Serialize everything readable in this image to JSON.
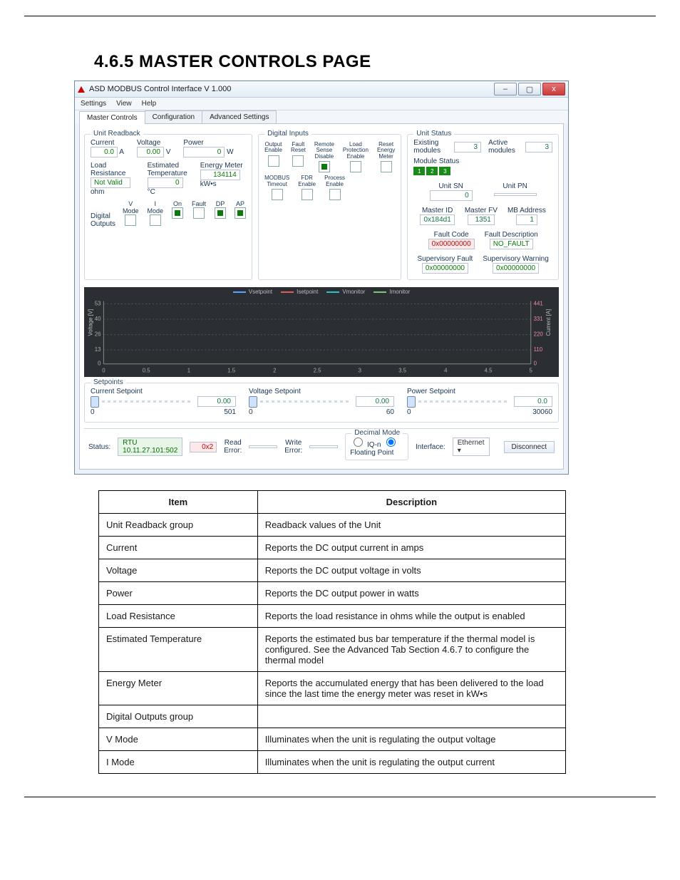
{
  "heading": "4.6.5  MASTER CONTROLS PAGE",
  "win": {
    "title": "ASD MODBUS Control Interface V 1.000",
    "menus": [
      "Settings",
      "View",
      "Help"
    ],
    "tabs": [
      "Master Controls",
      "Configuration",
      "Advanced Settings"
    ],
    "wbtn": {
      "min": "–",
      "max": "▢",
      "close": "x"
    }
  },
  "readback": {
    "legend": "Unit Readback",
    "current_lbl": "Current",
    "current_val": "0.0",
    "current_unit": "A",
    "voltage_lbl": "Voltage",
    "voltage_val": "0.00",
    "voltage_unit": "V",
    "power_lbl": "Power",
    "power_val": "0",
    "power_unit": "W",
    "loadres_lbl": "Load\nResistance",
    "loadres_val": "Not Valid",
    "loadres_unit": "ohm",
    "esttemp_lbl": "Estimated\nTemperature",
    "esttemp_val": "0",
    "esttemp_unit": "°C",
    "energy_lbl": "Energy Meter",
    "energy_val": "134114",
    "energy_unit": "kW•s",
    "dout_lbl": "Digital\nOutputs",
    "cols": {
      "vmode": "V Mode",
      "imode": "I Mode",
      "on": "On",
      "fault": "Fault",
      "dp": "DP",
      "ap": "AP"
    }
  },
  "digin": {
    "legend": "Digital Inputs",
    "row1": [
      {
        "a": "Output",
        "b": "Enable"
      },
      {
        "a": "Fault",
        "b": "Reset"
      },
      {
        "a": "Remote",
        "b": "Sense\nDisable"
      },
      {
        "a": "Load",
        "b": "Protection\nEnable"
      },
      {
        "a": "Reset",
        "b": "Energy\nMeter"
      }
    ],
    "row2": [
      {
        "a": "MODBUS",
        "b": "Timeout"
      },
      {
        "a": "FDR",
        "b": "Enable"
      },
      {
        "a": "Process",
        "b": "Enable"
      }
    ]
  },
  "unit": {
    "legend": "Unit Status",
    "existing_lbl": "Existing modules",
    "existing_val": "3",
    "active_lbl": "Active modules",
    "active_val": "3",
    "modstatus_lbl": "Module Status",
    "mods": [
      "1",
      "2",
      "3"
    ],
    "sn_lbl": "Unit SN",
    "sn_val": "0",
    "pn_lbl": "Unit PN",
    "pn_val": "",
    "mid_lbl": "Master ID",
    "mid_val": "0x184d1",
    "mfv_lbl": "Master FV",
    "mfv_val": "1351",
    "mba_lbl": "MB Address",
    "mba_val": "1",
    "fcode_lbl": "Fault Code",
    "fcode_val": "0x00000000",
    "fdesc_lbl": "Fault Description",
    "fdesc_val": "NO_FAULT",
    "sfault_lbl": "Supervisory Fault",
    "sfault_val": "0x00000000",
    "swarn_lbl": "Supervisory Warning",
    "swarn_val": "0x00000000"
  },
  "chart_data": {
    "type": "line",
    "title": "",
    "series": [
      {
        "name": "Vsetpoint",
        "color": "#52a7ff",
        "values": []
      },
      {
        "name": "Isetpoint",
        "color": "#e25b5b",
        "values": []
      },
      {
        "name": "Vmonitor",
        "color": "#2dc2c2",
        "values": []
      },
      {
        "name": "Imonitor",
        "color": "#7ac67a",
        "values": []
      }
    ],
    "x": {
      "label": "",
      "min": 0.0,
      "max": 5.0,
      "ticks": [
        0.0,
        0.5,
        1.0,
        1.5,
        2.0,
        2.5,
        3.0,
        3.5,
        4.0,
        4.5,
        5.0
      ]
    },
    "y_left": {
      "label": "Voltage [V]",
      "ticks": [
        0,
        13,
        26,
        40,
        53
      ]
    },
    "y_right": {
      "label": "Current [A]",
      "ticks": [
        0,
        110,
        220,
        331,
        441
      ]
    }
  },
  "setpoints": {
    "legend": "Setpoints",
    "current": {
      "lbl": "Current Setpoint",
      "val": "0.00",
      "min": "0",
      "max": "501"
    },
    "voltage": {
      "lbl": "Voltage Setpoint",
      "val": "0.00",
      "min": "0",
      "max": "60"
    },
    "power": {
      "lbl": "Power Setpoint",
      "val": "0.0",
      "min": "0",
      "max": "30060"
    }
  },
  "status": {
    "lbl": "Status:",
    "conn": "RTU 10.11.27.101:502",
    "err": "0x2",
    "readerr_a": "Read",
    "readerr_b": "Error:",
    "readerr_v": "",
    "writeerr_a": "Write",
    "writeerr_b": "Error:",
    "writeerr_v": "",
    "dec_lbl": "Decimal Mode",
    "opt1": "IQ-n",
    "opt2": "Floating Point",
    "iface_lbl": "Interface:",
    "iface_val": "Ethernet",
    "disc": "Disconnect"
  },
  "table": {
    "head": [
      "Item",
      "Description"
    ],
    "rows": [
      [
        "Unit Readback group",
        "Readback values of the Unit"
      ],
      [
        "Current",
        "Reports the DC output current in amps"
      ],
      [
        "Voltage",
        "Reports the DC output voltage in volts"
      ],
      [
        "Power",
        "Reports the DC output power in watts"
      ],
      [
        "Load Resistance",
        "Reports the load resistance in ohms while the output is enabled"
      ],
      [
        "Estimated Temperature",
        "Reports the estimated bus bar temperature if the thermal model is configured. See the Advanced Tab Section 4.6.7 to configure the thermal model"
      ],
      [
        "Energy Meter",
        "Reports the accumulated energy that has been delivered to the load since the last time the energy meter was reset in kW•s"
      ],
      [
        "Digital Outputs group",
        ""
      ],
      [
        "V Mode",
        "Illuminates when the unit is regulating the output voltage"
      ],
      [
        "I Mode",
        "Illuminates when the unit is regulating the output current"
      ]
    ]
  },
  "footer": {
    "left": "",
    "center": "",
    "right": ""
  }
}
